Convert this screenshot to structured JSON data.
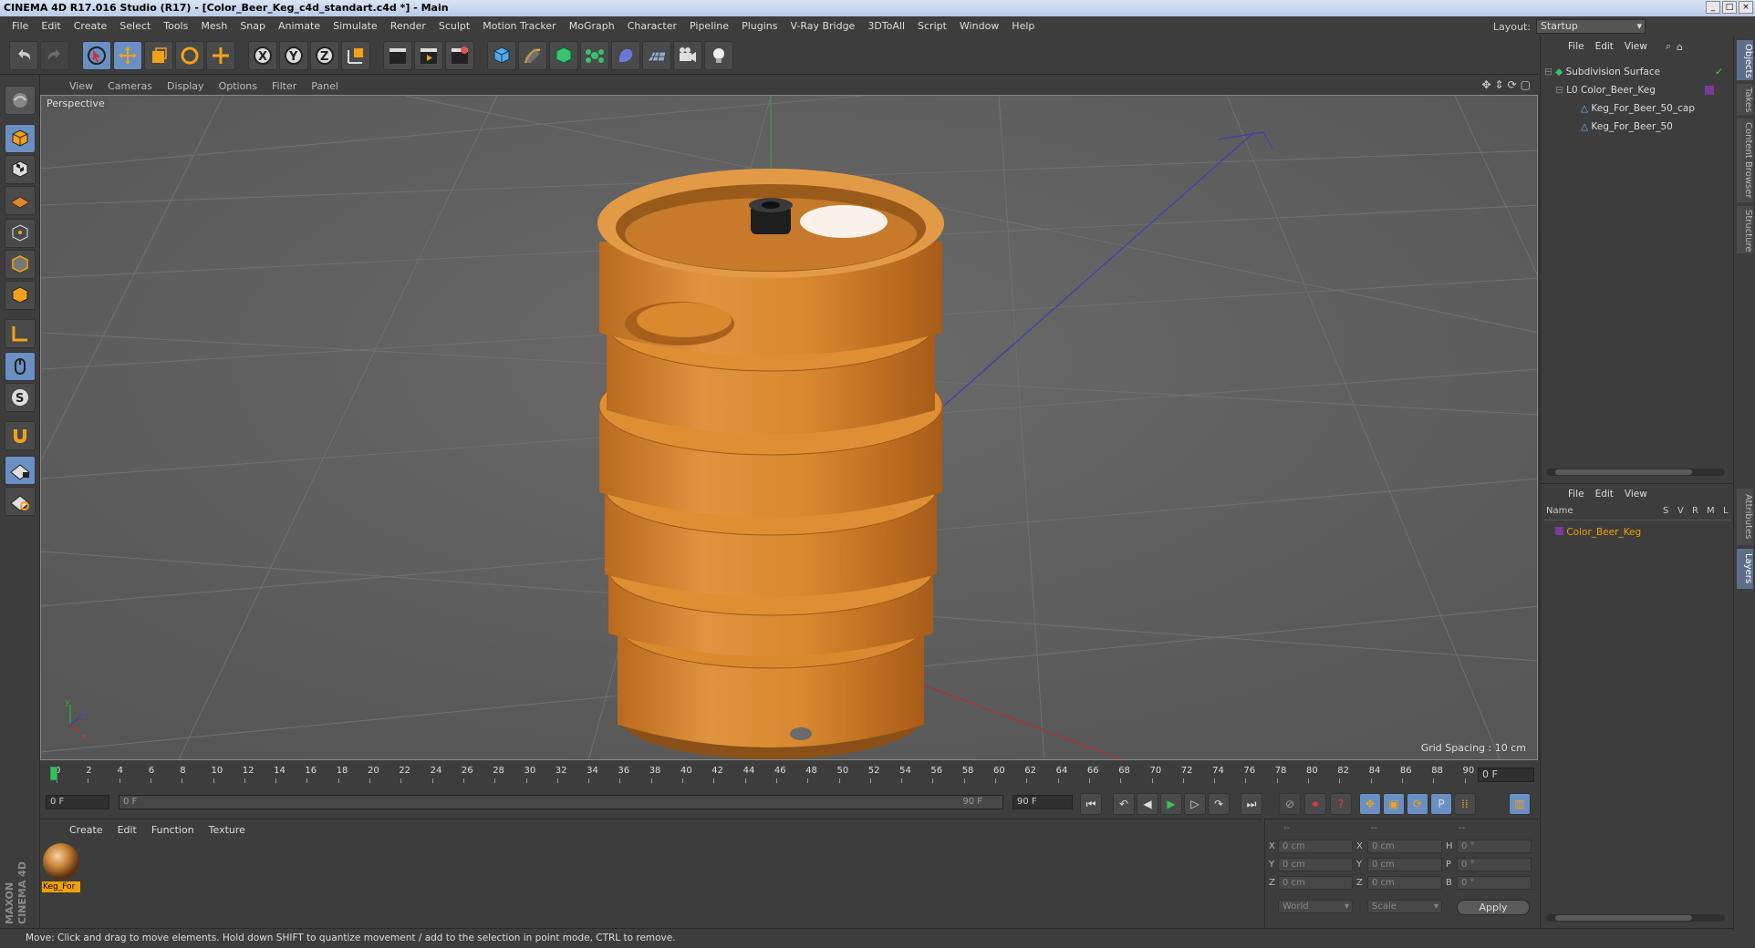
{
  "window": {
    "title": "CINEMA 4D R17.016 Studio (R17) - [Color_Beer_Keg_c4d_standart.c4d *] - Main"
  },
  "menubar": [
    "File",
    "Edit",
    "Create",
    "Select",
    "Tools",
    "Mesh",
    "Snap",
    "Animate",
    "Simulate",
    "Render",
    "Sculpt",
    "Motion Tracker",
    "MoGraph",
    "Character",
    "Pipeline",
    "Plugins",
    "V-Ray Bridge",
    "3DToAll",
    "Script",
    "Window",
    "Help"
  ],
  "layout": {
    "label": "Layout:",
    "value": "Startup"
  },
  "viewport": {
    "menu": [
      "View",
      "Cameras",
      "Display",
      "Options",
      "Filter",
      "Panel"
    ],
    "camera_label": "Perspective",
    "grid_spacing": "Grid Spacing : 10 cm",
    "axis": {
      "x": "x",
      "y": "y",
      "z": "z"
    }
  },
  "timeline": {
    "ticks": [
      "0",
      "2",
      "4",
      "6",
      "8",
      "10",
      "12",
      "14",
      "16",
      "18",
      "20",
      "22",
      "24",
      "26",
      "28",
      "30",
      "32",
      "34",
      "36",
      "38",
      "40",
      "42",
      "44",
      "46",
      "48",
      "50",
      "52",
      "54",
      "56",
      "58",
      "60",
      "62",
      "64",
      "66",
      "68",
      "70",
      "72",
      "74",
      "76",
      "78",
      "80",
      "82",
      "84",
      "86",
      "88",
      "90"
    ],
    "current_frame": "0 F",
    "start_frame": "0 F",
    "range_start": "0 F",
    "range_end": "90 F",
    "end_frame": "90 F"
  },
  "material_panel": {
    "menu": [
      "Create",
      "Edit",
      "Function",
      "Texture"
    ],
    "material_name": "Keg_For"
  },
  "coordinates": {
    "header": [
      "--",
      "--",
      "--"
    ],
    "rows": [
      {
        "l1": "X",
        "v1": "0 cm",
        "l2": "X",
        "v2": "0 cm",
        "l3": "H",
        "v3": "0 °"
      },
      {
        "l1": "Y",
        "v1": "0 cm",
        "l2": "Y",
        "v2": "0 cm",
        "l3": "P",
        "v3": "0 °"
      },
      {
        "l1": "Z",
        "v1": "0 cm",
        "l2": "Z",
        "v2": "0 cm",
        "l3": "B",
        "v3": "0 °"
      }
    ],
    "space": "World",
    "mode": "Scale",
    "apply": "Apply"
  },
  "object_manager": {
    "menu": [
      "File",
      "Edit",
      "View"
    ],
    "objects": [
      {
        "name": "Subdivision Surface"
      },
      {
        "name": "Color_Beer_Keg"
      },
      {
        "name": "Keg_For_Beer_50_cap"
      },
      {
        "name": "Keg_For_Beer_50"
      }
    ]
  },
  "layer_manager": {
    "menu": [
      "File",
      "Edit",
      "View"
    ],
    "columns": [
      "Name",
      "S",
      "V",
      "R",
      "M",
      "L"
    ],
    "layers": [
      {
        "name": "Color_Beer_Keg"
      }
    ]
  },
  "right_tabs": [
    "Objects",
    "Takes",
    "Content Browser",
    "Structure",
    "Attributes",
    "Layers"
  ],
  "status": "Move: Click and drag to move elements. Hold down SHIFT to quantize movement / add to the selection in point mode, CTRL to remove.",
  "brand": "MAXON CINEMA 4D",
  "colors": {
    "accent": "#6a8fc2",
    "keg": "#d9892e",
    "highlight": "#f0a000"
  }
}
